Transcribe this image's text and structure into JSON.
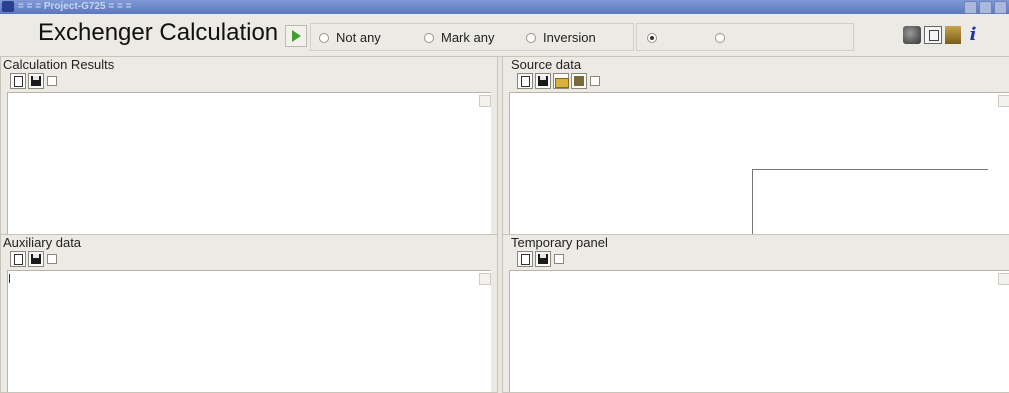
{
  "window": {
    "title": "= = = Project-G725 = = =",
    "app_icon": "app-logo-icon",
    "controls": [
      "minimize-icon",
      "maximize-icon",
      "close-icon"
    ]
  },
  "toolbar": {
    "app_title": "Exchenger Calculation",
    "run_icon": "play-icon",
    "radio_group_1": [
      {
        "label": "Not any",
        "selected": false
      },
      {
        "label": "Mark any",
        "selected": false
      },
      {
        "label": "Inversion",
        "selected": false
      }
    ],
    "radio_group_2": [
      {
        "label": "",
        "selected": true
      },
      {
        "label": "",
        "selected": false
      }
    ],
    "tool_icons": [
      "disk-icon",
      "copy-pages-icon",
      "tool-icon",
      "info-icon"
    ],
    "info_glyph": "i"
  },
  "panels": {
    "calculation_results": {
      "label": "Calculation Results",
      "buttons": [
        "new-icon",
        "save-icon"
      ]
    },
    "source_data": {
      "label": "Source data",
      "buttons": [
        "new-icon",
        "save-icon",
        "open-folder-icon",
        "import-icon"
      ]
    },
    "auxiliary_data": {
      "label": "Auxiliary data",
      "buttons": [
        "new-icon",
        "save-icon"
      ]
    },
    "temporary_panel": {
      "label": "Temporary panel",
      "buttons": [
        "new-icon",
        "save-icon"
      ]
    }
  },
  "colors": {
    "titlebar": "#6a86c8",
    "background": "#eceae4",
    "run_accent": "#3fa02e",
    "info_accent": "#2033a8"
  }
}
